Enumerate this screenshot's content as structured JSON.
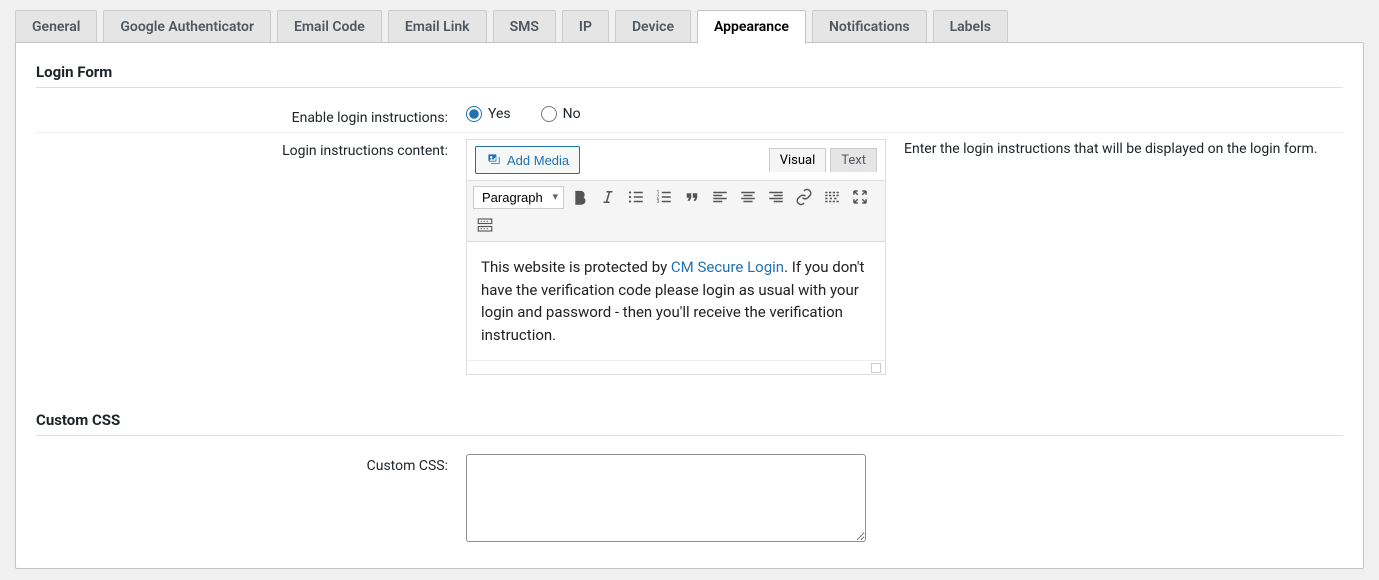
{
  "tabs": [
    "General",
    "Google Authenticator",
    "Email Code",
    "Email Link",
    "SMS",
    "IP",
    "Device",
    "Appearance",
    "Notifications",
    "Labels"
  ],
  "active_tab_index": 7,
  "sections": {
    "login_form": {
      "title": "Login Form",
      "enable_label": "Enable login instructions:",
      "enable_options": {
        "yes": "Yes",
        "no": "No"
      },
      "enable_value": "yes",
      "content_label": "Login instructions content:",
      "add_media_label": "Add Media",
      "editor_tabs": {
        "visual": "Visual",
        "text": "Text"
      },
      "editor_active_tab": "visual",
      "format_selected": "Paragraph",
      "content_text_before": "This website is protected by ",
      "content_link_text": "CM Secure Login",
      "content_text_after": ". If you don't have the verification code please login as usual with your login and password - then you'll receive the verification instruction.",
      "help_text": "Enter the login instructions that will be displayed on the login form."
    },
    "custom_css": {
      "title": "Custom CSS",
      "label": "Custom CSS:",
      "value": ""
    }
  }
}
